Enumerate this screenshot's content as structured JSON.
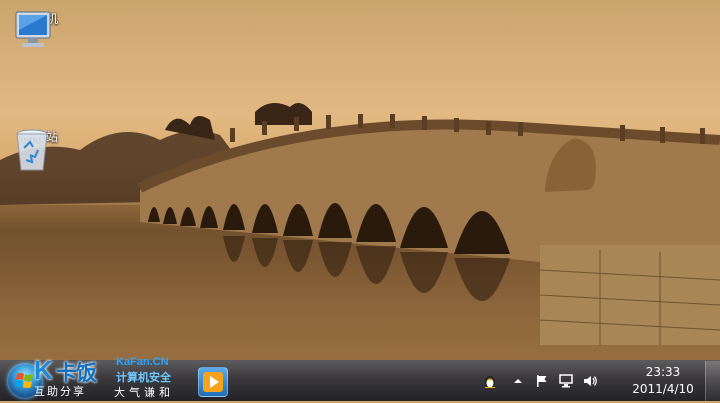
{
  "desktop": {
    "icons": [
      {
        "label": "计算机",
        "icon": "computer-icon"
      },
      {
        "label": "回收站",
        "icon": "recycle-bin-icon"
      }
    ]
  },
  "taskbar": {
    "brand": {
      "k": "K",
      "name": "卡饭",
      "sub": "互助分享",
      "url": "KaFan.CN",
      "slogan": "计算机安全",
      "mood": "大气谦和"
    },
    "pinned": [
      {
        "icon": "media-player-icon"
      }
    ],
    "tray": {
      "icons": [
        "qq-penguin-icon",
        "show-hidden-icons-arrow",
        "action-center-flag-icon",
        "network-icon",
        "volume-icon"
      ],
      "clock": {
        "time": "23:33",
        "date": "2011/4/10"
      }
    }
  }
}
